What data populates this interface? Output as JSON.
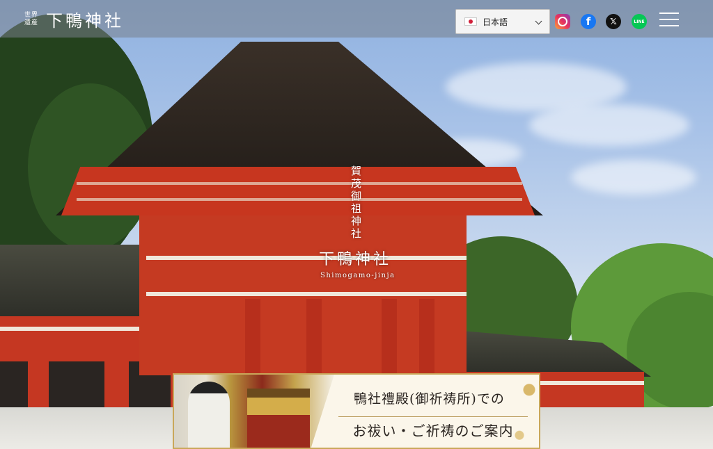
{
  "header": {
    "logo_badge_line1": "世界",
    "logo_badge_line2": "遺産",
    "logo_name": "下鴨神社",
    "language": {
      "selected": "日本語",
      "flag_icon": "japan-flag-icon"
    },
    "social": [
      {
        "name": "instagram-icon",
        "color": "#e6325f"
      },
      {
        "name": "facebook-icon",
        "color": "#1877f2",
        "glyph": "f"
      },
      {
        "name": "x-icon",
        "color": "#111111",
        "glyph": "𝕏"
      },
      {
        "name": "line-icon",
        "color": "#06c755",
        "glyph": "LINE"
      }
    ],
    "menu_icon": "hamburger-menu-icon"
  },
  "hero": {
    "subtitle_vertical": "賀茂御祖神社",
    "title": "下鴨神社",
    "romanized": "Shimogamo-jinja"
  },
  "banner": {
    "line1": "鴨社禮殿(御祈祷所)での",
    "line2": "お祓い・ご祈祷のご案内",
    "accent_color": "#c9a75a"
  }
}
